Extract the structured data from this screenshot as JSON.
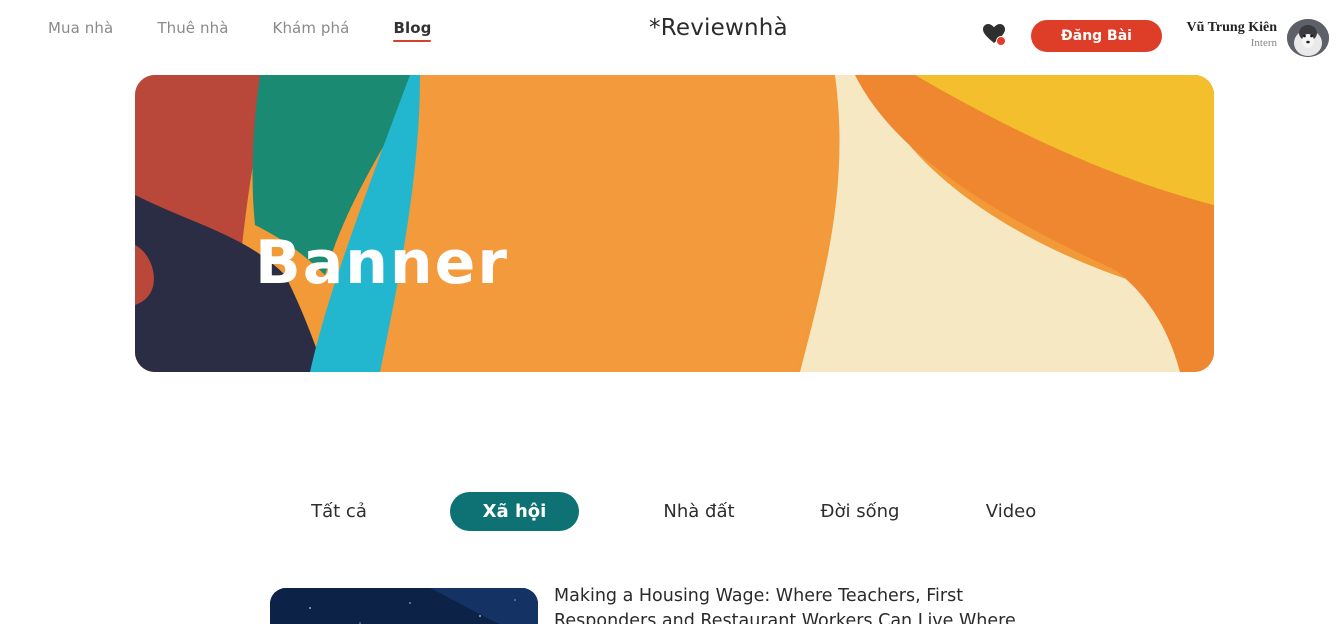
{
  "nav": {
    "items": [
      {
        "label": "Mua nhà"
      },
      {
        "label": "Thuê nhà"
      },
      {
        "label": "Khám phá"
      },
      {
        "label": "Blog"
      }
    ]
  },
  "brand": {
    "logo": "*Reviewnhà"
  },
  "header": {
    "post_button": "Đăng Bài",
    "user_name": "Vũ Trung Kiên",
    "user_role": "Intern",
    "notification_icon": "heart-icon",
    "accent_color": "#de3d28"
  },
  "banner": {
    "text": "Banner"
  },
  "tabs": {
    "items": [
      {
        "label": "Tất cả"
      },
      {
        "label": "Xã hội"
      },
      {
        "label": "Nhà đất"
      },
      {
        "label": "Đời sống"
      },
      {
        "label": "Video"
      }
    ],
    "active_color": "#0e7275"
  },
  "article": {
    "title": "Making a Housing Wage: Where Teachers, First Responders and Restaurant Workers Can Live Where"
  }
}
